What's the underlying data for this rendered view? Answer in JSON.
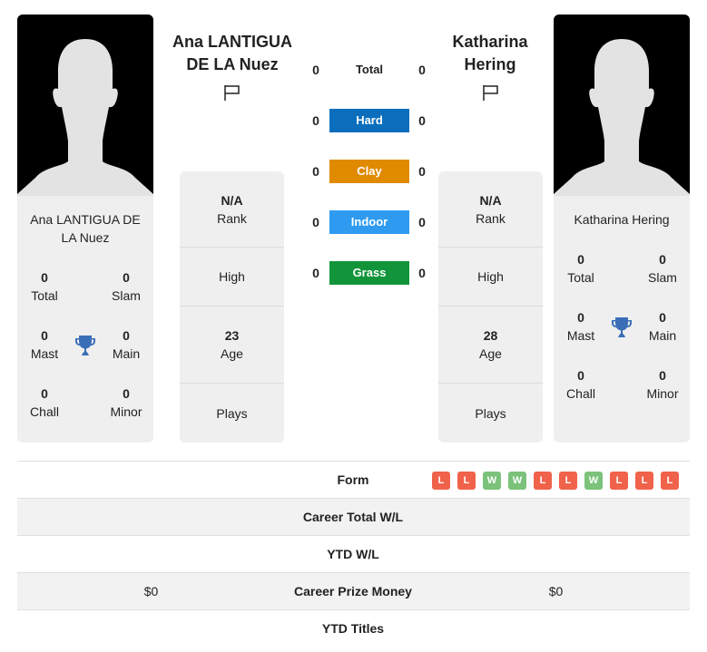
{
  "players": {
    "left": {
      "header_name": "Ana LANTIGUA DE LA Nuez",
      "card_name": "Ana LANTIGUA DE LA Nuez",
      "flag_icon": "flag-icon",
      "titles": {
        "total": {
          "value": "0",
          "label": "Total"
        },
        "slam": {
          "value": "0",
          "label": "Slam"
        },
        "mast": {
          "value": "0",
          "label": "Mast"
        },
        "main": {
          "value": "0",
          "label": "Main"
        },
        "chall": {
          "value": "0",
          "label": "Chall"
        },
        "minor": {
          "value": "0",
          "label": "Minor"
        }
      },
      "info": {
        "rank": {
          "value": "N/A",
          "label": "Rank"
        },
        "high": {
          "label": "High"
        },
        "age": {
          "value": "23",
          "label": "Age"
        },
        "plays": {
          "label": "Plays"
        }
      }
    },
    "right": {
      "header_name": "Katharina Hering",
      "card_name": "Katharina Hering",
      "flag_icon": "flag-icon",
      "titles": {
        "total": {
          "value": "0",
          "label": "Total"
        },
        "slam": {
          "value": "0",
          "label": "Slam"
        },
        "mast": {
          "value": "0",
          "label": "Mast"
        },
        "main": {
          "value": "0",
          "label": "Main"
        },
        "chall": {
          "value": "0",
          "label": "Chall"
        },
        "minor": {
          "value": "0",
          "label": "Minor"
        }
      },
      "info": {
        "rank": {
          "value": "N/A",
          "label": "Rank"
        },
        "high": {
          "label": "High"
        },
        "age": {
          "value": "28",
          "label": "Age"
        },
        "plays": {
          "label": "Plays"
        }
      }
    }
  },
  "surfaces": [
    {
      "label": "Total",
      "left": "0",
      "right": "0",
      "color": ""
    },
    {
      "label": "Hard",
      "left": "0",
      "right": "0",
      "color": "#0a6ebd"
    },
    {
      "label": "Clay",
      "left": "0",
      "right": "0",
      "color": "#e08a00"
    },
    {
      "label": "Indoor",
      "left": "0",
      "right": "0",
      "color": "#2e9bf0"
    },
    {
      "label": "Grass",
      "left": "0",
      "right": "0",
      "color": "#12953a"
    }
  ],
  "comparison": {
    "form": {
      "label": "Form",
      "results": [
        "L",
        "L",
        "W",
        "W",
        "L",
        "L",
        "W",
        "L",
        "L",
        "L"
      ],
      "colors": {
        "W": "#7bc27b",
        "L": "#f0624a"
      }
    },
    "rows": [
      {
        "label": "Career Total W/L",
        "left": "",
        "right": ""
      },
      {
        "label": "YTD W/L",
        "left": "",
        "right": ""
      },
      {
        "label": "Career Prize Money",
        "left": "$0",
        "right": "$0"
      },
      {
        "label": "YTD Titles",
        "left": "",
        "right": ""
      }
    ]
  },
  "icons": {
    "trophy": "trophy-icon",
    "avatar": "avatar-silhouette-icon"
  },
  "colors": {
    "trophy": "#3a6fb8",
    "card_bg": "#efefef"
  }
}
